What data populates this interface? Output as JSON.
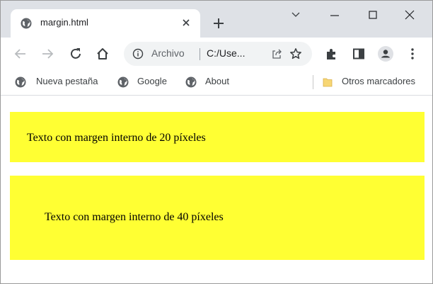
{
  "tab": {
    "title": "margin.html",
    "favicon": "globe-icon"
  },
  "toolbar": {
    "omnibox": {
      "scheme_label": "Archivo",
      "url": "C:/Use..."
    }
  },
  "bookmarks": {
    "items": [
      {
        "label": "Nueva pestaña",
        "icon": "globe-icon"
      },
      {
        "label": "Google",
        "icon": "globe-icon"
      },
      {
        "label": "About",
        "icon": "globe-icon"
      }
    ],
    "other": {
      "label": "Otros marcadores",
      "icon": "folder-icon"
    }
  },
  "page": {
    "box1_text": "Texto con margen interno de 20 píxeles",
    "box2_text": "Texto con margen interno de 40 píxeles"
  },
  "colors": {
    "box_background": "#ffff33",
    "tabstrip": "#dee1e6",
    "omnibox": "#f1f3f4"
  }
}
